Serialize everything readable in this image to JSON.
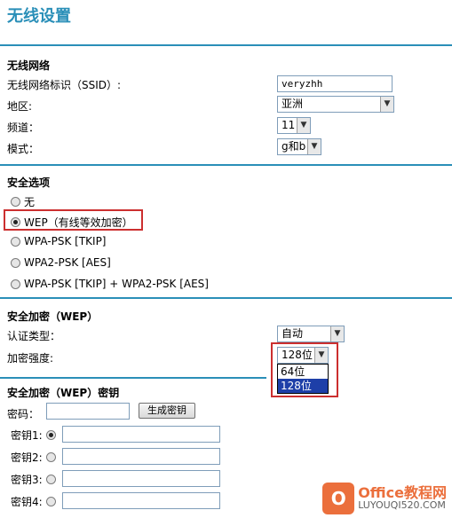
{
  "page": {
    "title": "无线设置"
  },
  "wireless": {
    "section": "无线网络",
    "ssid_label": "无线网络标识（SSID）:",
    "ssid_value": "veryzhh",
    "region_label": "地区:",
    "region_value": "亚洲",
    "channel_label": "频道：",
    "channel_value": "11",
    "mode_label": "模式：",
    "mode_value": "g和b"
  },
  "security_options": {
    "section": "安全选项",
    "options": [
      {
        "label": "无",
        "selected": false
      },
      {
        "label": "WEP（有线等效加密）",
        "selected": true
      },
      {
        "label": "WPA-PSK [TKIP]",
        "selected": false
      },
      {
        "label": "WPA2-PSK [AES]",
        "selected": false
      },
      {
        "label": "WPA-PSK [TKIP] + WPA2-PSK [AES]",
        "selected": false
      }
    ]
  },
  "encryption": {
    "section": "安全加密（WEP）",
    "auth_label": "认证类型：",
    "auth_value": "自动",
    "strength_label": "加密强度:",
    "strength_value": "128位",
    "strength_options": [
      "64位",
      "128位"
    ]
  },
  "keys": {
    "section": "安全加密（WEP）密钥",
    "password_label": "密码：",
    "password_value": "",
    "generate_button": "生成密钥",
    "items": [
      {
        "label": "密钥1:",
        "selected": true,
        "value": ""
      },
      {
        "label": "密钥2:",
        "selected": false,
        "value": ""
      },
      {
        "label": "密钥3:",
        "selected": false,
        "value": ""
      },
      {
        "label": "密钥4:",
        "selected": false,
        "value": ""
      }
    ]
  },
  "watermark": {
    "logo": "O",
    "brand": "Office教程网",
    "site": "LUYOUQI520.COM"
  },
  "colors": {
    "accent": "#2a8fb8",
    "highlight": "#cc2f2f",
    "selection": "#1e3fa8"
  }
}
